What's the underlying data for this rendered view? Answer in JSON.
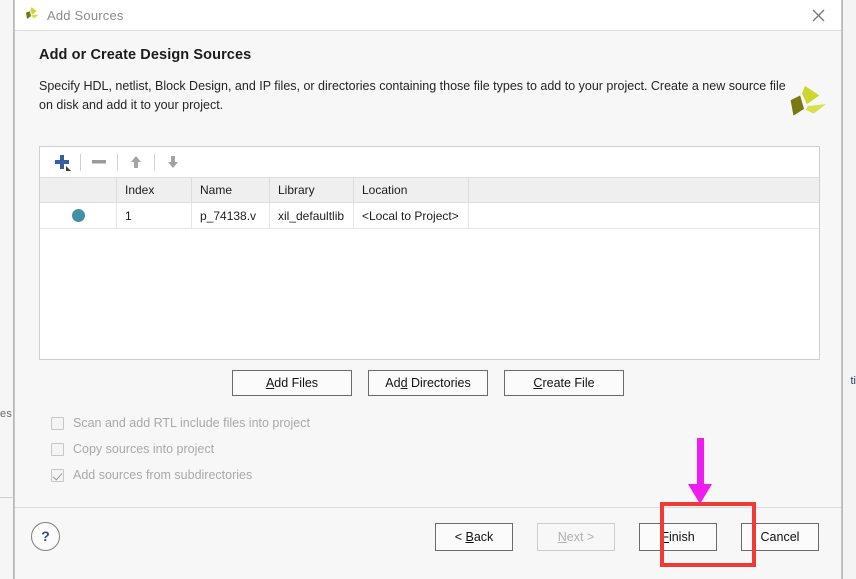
{
  "window": {
    "title": "Add Sources",
    "logo_icon": "vivado-logo-icon",
    "close_icon": "close-icon"
  },
  "header": {
    "title": "Add or Create Design Sources",
    "description": "Specify HDL, netlist, Block Design, and IP files, or directories containing those file types to add to your project. Create a new source file on disk and add it to your project.",
    "logo_icon": "vivado-logo-icon"
  },
  "sources_panel": {
    "toolbar": {
      "add_icon": "plus-icon",
      "remove_icon": "minus-icon",
      "move_up_icon": "arrow-up-icon",
      "move_down_icon": "arrow-down-icon"
    },
    "columns": [
      "",
      "Index",
      "Name",
      "Library",
      "Location",
      ""
    ],
    "rows": [
      {
        "status_icon": "file-status-dot-icon",
        "index": "1",
        "name": "p_74138.v",
        "library": "xil_defaultlib",
        "location": "<Local to Project>"
      }
    ]
  },
  "mid_buttons": [
    {
      "label": "Add Files",
      "mnemonic_index": 0
    },
    {
      "label": "Add Directories",
      "mnemonic_index": 2
    },
    {
      "label": "Create File",
      "mnemonic_index": 0
    }
  ],
  "options": [
    {
      "label": "Scan and add RTL include files into project",
      "checked": false,
      "enabled": false
    },
    {
      "label": "Copy sources into project",
      "checked": false,
      "enabled": false
    },
    {
      "label": "Add sources from subdirectories",
      "checked": true,
      "enabled": false
    }
  ],
  "footer": {
    "help_label": "?",
    "back_label": "< Back",
    "next_label": "Next >",
    "finish_label": "Finish",
    "cancel_label": "Cancel"
  },
  "annotations": {
    "highlight_color": "#f03a34",
    "arrow_color": "#ef1cef",
    "highlight_target": "Finish"
  },
  "background": {
    "left_text": "es",
    "right_text": "ti"
  }
}
